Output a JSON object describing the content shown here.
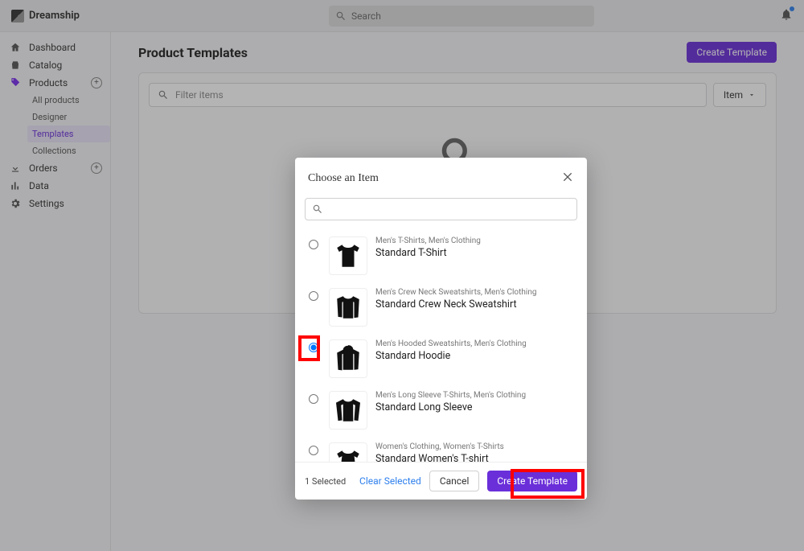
{
  "brand": "Dreamship",
  "topbar": {
    "search_placeholder": "Search"
  },
  "sidebar": {
    "dashboard": "Dashboard",
    "catalog": "Catalog",
    "products": "Products",
    "sub": {
      "all": "All products",
      "designer": "Designer",
      "templates": "Templates",
      "collections": "Collections"
    },
    "orders": "Orders",
    "data": "Data",
    "settings": "Settings"
  },
  "page": {
    "title": "Product Templates",
    "create_btn": "Create Template",
    "filter_placeholder": "Filter items",
    "item_btn": "Item"
  },
  "dialog": {
    "title": "Choose an Item",
    "items": [
      {
        "cat": "Men's T-Shirts, Men's Clothing",
        "name": "Standard T-Shirt",
        "selected": false
      },
      {
        "cat": "Men's Crew Neck Sweatshirts, Men's Clothing",
        "name": "Standard Crew Neck Sweatshirt",
        "selected": false
      },
      {
        "cat": "Men's Hooded Sweatshirts, Men's Clothing",
        "name": "Standard Hoodie",
        "selected": true
      },
      {
        "cat": "Men's Long Sleeve T-Shirts, Men's Clothing",
        "name": "Standard Long Sleeve",
        "selected": false
      },
      {
        "cat": "Women's Clothing, Women's T-Shirts",
        "name": "Standard Women's T-shirt",
        "selected": false
      }
    ],
    "footer": {
      "selected_text": "1 Selected",
      "clear": "Clear Selected",
      "cancel": "Cancel",
      "create": "Create Template"
    }
  }
}
